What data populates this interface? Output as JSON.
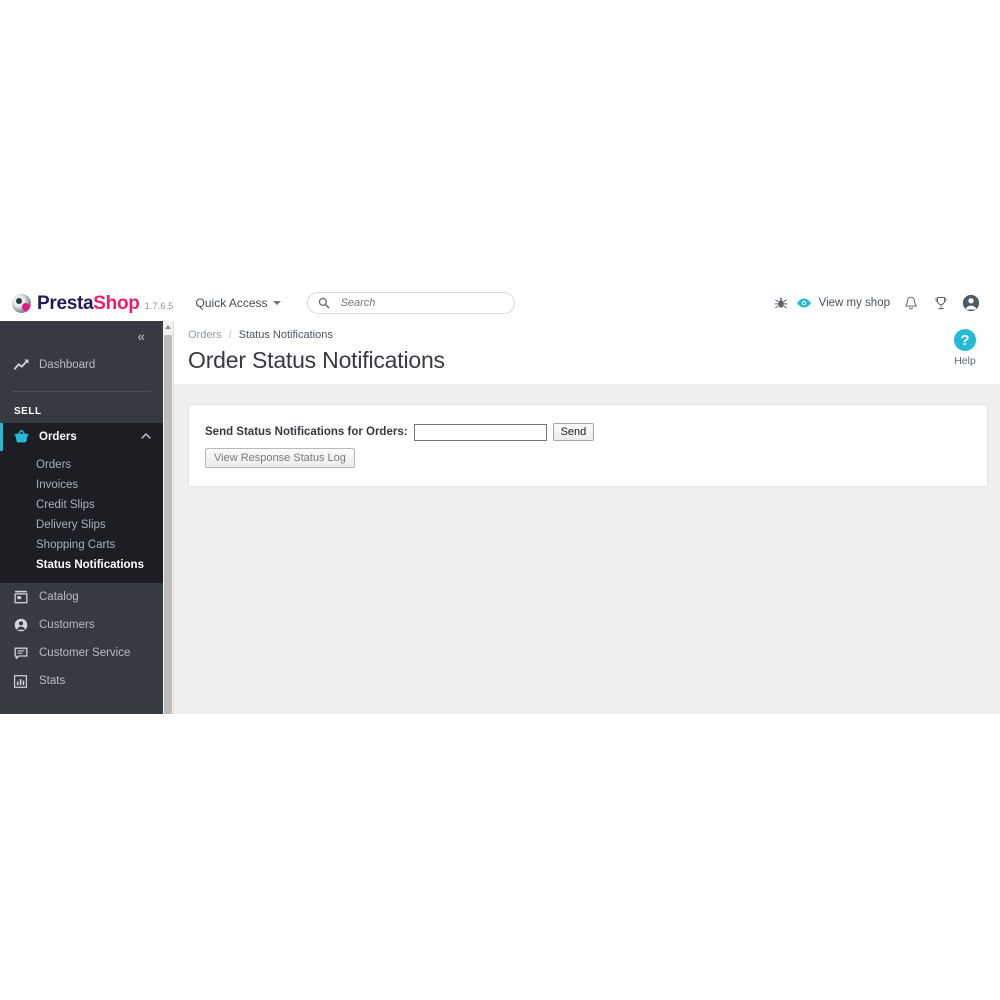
{
  "header": {
    "logo": {
      "presta": "Presta",
      "shop": "Shop",
      "version": "1.7.6.5",
      "mark_icon": "prestashop-logo-icon"
    },
    "quick_access_label": "Quick Access",
    "search": {
      "placeholder": "Search",
      "value": "",
      "icon": "search-icon"
    },
    "debug_icon": "bug-icon",
    "view_shop": {
      "label": "View my shop",
      "icon": "eye-icon"
    },
    "notifications_icon": "bell-icon",
    "achievements_icon": "trophy-icon",
    "account_icon": "user-circle-icon"
  },
  "sidebar": {
    "collapse_label": "«",
    "section_title": "SELL",
    "items": [
      {
        "label": "Dashboard",
        "icon": "trending-up-icon",
        "active": false
      },
      {
        "label": "Orders",
        "icon": "shopping-basket-icon",
        "active": true,
        "chevron": "chevron-up-icon"
      },
      {
        "label": "Catalog",
        "icon": "store-icon",
        "active": false
      },
      {
        "label": "Customers",
        "icon": "user-circle-icon",
        "active": false
      },
      {
        "label": "Customer Service",
        "icon": "chat-bubble-icon",
        "active": false
      },
      {
        "label": "Stats",
        "icon": "bar-chart-icon",
        "active": false
      }
    ],
    "submenu": [
      {
        "label": "Orders",
        "current": false
      },
      {
        "label": "Invoices",
        "current": false
      },
      {
        "label": "Credit Slips",
        "current": false
      },
      {
        "label": "Delivery Slips",
        "current": false
      },
      {
        "label": "Shopping Carts",
        "current": false
      },
      {
        "label": "Status Notifications",
        "current": true
      }
    ]
  },
  "content": {
    "breadcrumb": {
      "parent": "Orders",
      "separator": "/",
      "current": "Status Notifications"
    },
    "page_title": "Order Status Notifications",
    "help": {
      "label": "Help",
      "glyph": "?",
      "icon": "help-circle-icon"
    },
    "form": {
      "field_label": "Send Status Notifications for Orders:",
      "field_value": "",
      "field_placeholder": "",
      "send_button": "Send",
      "log_button": "View Response Status Log"
    }
  },
  "colors": {
    "accent_cyan": "#25b9d7",
    "brand_pink": "#ec1d6d",
    "brand_navy": "#251b5b",
    "sidebar_bg": "#363a41",
    "submenu_bg": "#1d1e23",
    "content_bg": "#eef0f1"
  }
}
